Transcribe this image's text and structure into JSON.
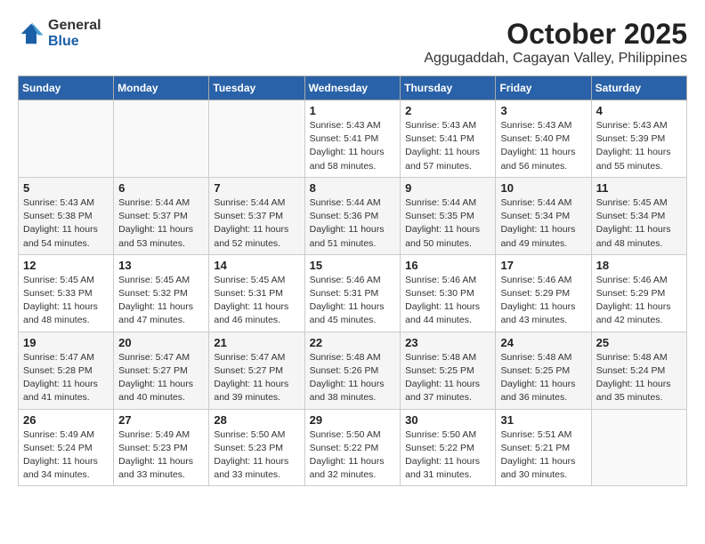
{
  "logo": {
    "general": "General",
    "blue": "Blue"
  },
  "header": {
    "month": "October 2025",
    "location": "Aggugaddah, Cagayan Valley, Philippines"
  },
  "weekdays": [
    "Sunday",
    "Monday",
    "Tuesday",
    "Wednesday",
    "Thursday",
    "Friday",
    "Saturday"
  ],
  "weeks": [
    [
      null,
      null,
      null,
      {
        "day": 1,
        "sunrise": "5:43 AM",
        "sunset": "5:41 PM",
        "daylight": "11 hours and 58 minutes."
      },
      {
        "day": 2,
        "sunrise": "5:43 AM",
        "sunset": "5:41 PM",
        "daylight": "11 hours and 57 minutes."
      },
      {
        "day": 3,
        "sunrise": "5:43 AM",
        "sunset": "5:40 PM",
        "daylight": "11 hours and 56 minutes."
      },
      {
        "day": 4,
        "sunrise": "5:43 AM",
        "sunset": "5:39 PM",
        "daylight": "11 hours and 55 minutes."
      }
    ],
    [
      {
        "day": 5,
        "sunrise": "5:43 AM",
        "sunset": "5:38 PM",
        "daylight": "11 hours and 54 minutes."
      },
      {
        "day": 6,
        "sunrise": "5:44 AM",
        "sunset": "5:37 PM",
        "daylight": "11 hours and 53 minutes."
      },
      {
        "day": 7,
        "sunrise": "5:44 AM",
        "sunset": "5:37 PM",
        "daylight": "11 hours and 52 minutes."
      },
      {
        "day": 8,
        "sunrise": "5:44 AM",
        "sunset": "5:36 PM",
        "daylight": "11 hours and 51 minutes."
      },
      {
        "day": 9,
        "sunrise": "5:44 AM",
        "sunset": "5:35 PM",
        "daylight": "11 hours and 50 minutes."
      },
      {
        "day": 10,
        "sunrise": "5:44 AM",
        "sunset": "5:34 PM",
        "daylight": "11 hours and 49 minutes."
      },
      {
        "day": 11,
        "sunrise": "5:45 AM",
        "sunset": "5:34 PM",
        "daylight": "11 hours and 48 minutes."
      }
    ],
    [
      {
        "day": 12,
        "sunrise": "5:45 AM",
        "sunset": "5:33 PM",
        "daylight": "11 hours and 48 minutes."
      },
      {
        "day": 13,
        "sunrise": "5:45 AM",
        "sunset": "5:32 PM",
        "daylight": "11 hours and 47 minutes."
      },
      {
        "day": 14,
        "sunrise": "5:45 AM",
        "sunset": "5:31 PM",
        "daylight": "11 hours and 46 minutes."
      },
      {
        "day": 15,
        "sunrise": "5:46 AM",
        "sunset": "5:31 PM",
        "daylight": "11 hours and 45 minutes."
      },
      {
        "day": 16,
        "sunrise": "5:46 AM",
        "sunset": "5:30 PM",
        "daylight": "11 hours and 44 minutes."
      },
      {
        "day": 17,
        "sunrise": "5:46 AM",
        "sunset": "5:29 PM",
        "daylight": "11 hours and 43 minutes."
      },
      {
        "day": 18,
        "sunrise": "5:46 AM",
        "sunset": "5:29 PM",
        "daylight": "11 hours and 42 minutes."
      }
    ],
    [
      {
        "day": 19,
        "sunrise": "5:47 AM",
        "sunset": "5:28 PM",
        "daylight": "11 hours and 41 minutes."
      },
      {
        "day": 20,
        "sunrise": "5:47 AM",
        "sunset": "5:27 PM",
        "daylight": "11 hours and 40 minutes."
      },
      {
        "day": 21,
        "sunrise": "5:47 AM",
        "sunset": "5:27 PM",
        "daylight": "11 hours and 39 minutes."
      },
      {
        "day": 22,
        "sunrise": "5:48 AM",
        "sunset": "5:26 PM",
        "daylight": "11 hours and 38 minutes."
      },
      {
        "day": 23,
        "sunrise": "5:48 AM",
        "sunset": "5:25 PM",
        "daylight": "11 hours and 37 minutes."
      },
      {
        "day": 24,
        "sunrise": "5:48 AM",
        "sunset": "5:25 PM",
        "daylight": "11 hours and 36 minutes."
      },
      {
        "day": 25,
        "sunrise": "5:48 AM",
        "sunset": "5:24 PM",
        "daylight": "11 hours and 35 minutes."
      }
    ],
    [
      {
        "day": 26,
        "sunrise": "5:49 AM",
        "sunset": "5:24 PM",
        "daylight": "11 hours and 34 minutes."
      },
      {
        "day": 27,
        "sunrise": "5:49 AM",
        "sunset": "5:23 PM",
        "daylight": "11 hours and 33 minutes."
      },
      {
        "day": 28,
        "sunrise": "5:50 AM",
        "sunset": "5:23 PM",
        "daylight": "11 hours and 33 minutes."
      },
      {
        "day": 29,
        "sunrise": "5:50 AM",
        "sunset": "5:22 PM",
        "daylight": "11 hours and 32 minutes."
      },
      {
        "day": 30,
        "sunrise": "5:50 AM",
        "sunset": "5:22 PM",
        "daylight": "11 hours and 31 minutes."
      },
      {
        "day": 31,
        "sunrise": "5:51 AM",
        "sunset": "5:21 PM",
        "daylight": "11 hours and 30 minutes."
      },
      null
    ]
  ],
  "labels": {
    "sunrise": "Sunrise:",
    "sunset": "Sunset:",
    "daylight": "Daylight:"
  }
}
